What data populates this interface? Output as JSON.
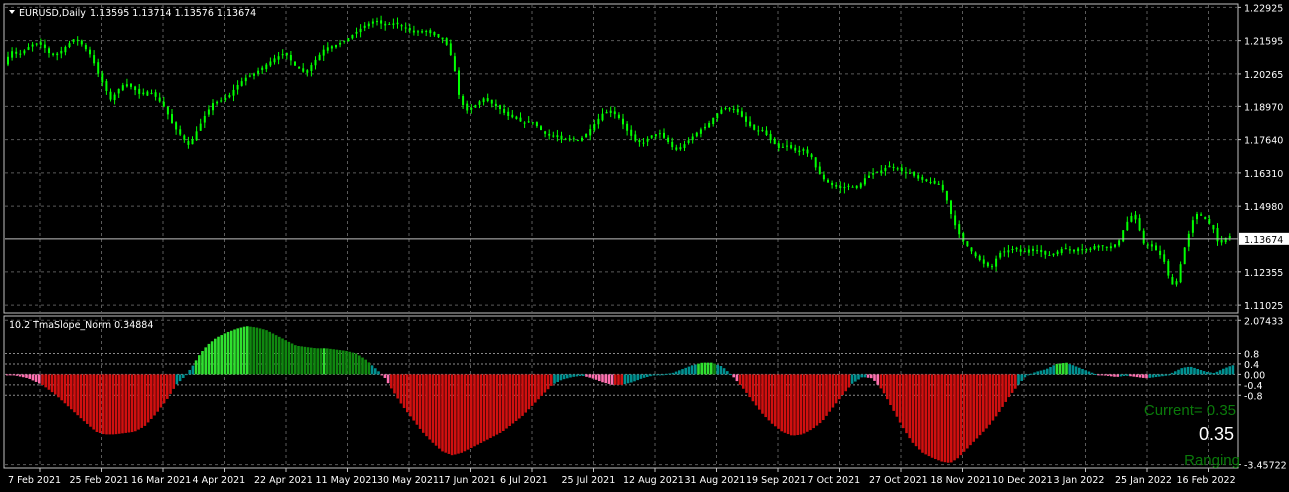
{
  "main_panel": {
    "title": "EURUSD,Daily",
    "ohlc": "1.13595 1.13714 1.13576 1.13674",
    "last_price": "1.13674",
    "price_ticks": [
      "1.22925",
      "1.21595",
      "1.20265",
      "1.18970",
      "1.17640",
      "1.16310",
      "1.14980",
      "1.13674",
      "1.12355",
      "1.11025"
    ]
  },
  "indicator_panel": {
    "title": "10.2 TmaSlope_Norm 0.34884",
    "value_ticks": [
      "2.07433",
      "0.8",
      "0.4",
      "0.00",
      "-0.4",
      "-0.8",
      "-3.45722"
    ],
    "info_current": "Current= 0.35",
    "info_value": "0.35",
    "info_state": "Ranging"
  },
  "time_axis": {
    "labels": [
      "7 Feb 2021",
      "25 Feb 2021",
      "16 Mar 2021",
      "4 Apr 2021",
      "22 Apr 2021",
      "11 May 2021",
      "30 May 2021",
      "17 Jun 2021",
      "6 Jul 2021",
      "25 Jul 2021",
      "12 Aug 2021",
      "31 Aug 2021",
      "19 Sep 2021",
      "7 Oct 2021",
      "27 Oct 2021",
      "18 Nov 2021",
      "10 Dec 2021",
      "3 Jan 2022",
      "25 Jan 2022",
      "16 Feb 2022"
    ]
  },
  "colors": {
    "background": "#000000",
    "grid": "#5a5a5a",
    "candle": "#00ff00",
    "bid_line": "#c0c0c0",
    "hist_red": "#d01010",
    "hist_pink": "#ff70b0",
    "hist_teal": "#009090",
    "hist_lime": "#30e030",
    "hist_green": "#108810"
  },
  "chart_data": [
    {
      "type": "candlestick",
      "title": "EURUSD,Daily",
      "ylim": [
        1.11025,
        1.22925
      ],
      "grid": true,
      "price_path": [
        [
          0,
          1.207
        ],
        [
          6,
          1.212
        ],
        [
          14,
          1.21
        ],
        [
          22,
          1.213
        ],
        [
          30,
          1.215
        ],
        [
          38,
          1.214
        ],
        [
          46,
          1.21
        ],
        [
          54,
          1.211
        ],
        [
          62,
          1.214
        ],
        [
          70,
          1.217
        ],
        [
          78,
          1.214
        ],
        [
          86,
          1.21
        ],
        [
          94,
          1.202
        ],
        [
          100,
          1.197
        ],
        [
          106,
          1.192
        ],
        [
          112,
          1.196
        ],
        [
          120,
          1.199
        ],
        [
          128,
          1.197
        ],
        [
          136,
          1.194
        ],
        [
          144,
          1.196
        ],
        [
          152,
          1.193
        ],
        [
          160,
          1.189
        ],
        [
          168,
          1.182
        ],
        [
          176,
          1.178
        ],
        [
          184,
          1.174
        ],
        [
          192,
          1.18
        ],
        [
          200,
          1.186
        ],
        [
          208,
          1.191
        ],
        [
          216,
          1.192
        ],
        [
          224,
          1.194
        ],
        [
          232,
          1.198
        ],
        [
          240,
          1.201
        ],
        [
          250,
          1.203
        ],
        [
          260,
          1.206
        ],
        [
          270,
          1.209
        ],
        [
          280,
          1.211
        ],
        [
          290,
          1.206
        ],
        [
          300,
          1.203
        ],
        [
          310,
          1.208
        ],
        [
          320,
          1.213
        ],
        [
          330,
          1.214
        ],
        [
          340,
          1.216
        ],
        [
          350,
          1.219
        ],
        [
          360,
          1.222
        ],
        [
          370,
          1.224
        ],
        [
          380,
          1.222
        ],
        [
          390,
          1.223
        ],
        [
          400,
          1.221
        ],
        [
          410,
          1.219
        ],
        [
          420,
          1.22
        ],
        [
          430,
          1.218
        ],
        [
          440,
          1.216
        ],
        [
          448,
          1.208
        ],
        [
          455,
          1.192
        ],
        [
          462,
          1.188
        ],
        [
          470,
          1.19
        ],
        [
          478,
          1.193
        ],
        [
          486,
          1.191
        ],
        [
          494,
          1.189
        ],
        [
          502,
          1.186
        ],
        [
          510,
          1.185
        ],
        [
          518,
          1.183
        ],
        [
          526,
          1.184
        ],
        [
          534,
          1.181
        ],
        [
          542,
          1.178
        ],
        [
          550,
          1.178
        ],
        [
          558,
          1.176
        ],
        [
          566,
          1.177
        ],
        [
          574,
          1.176
        ],
        [
          582,
          1.179
        ],
        [
          590,
          1.183
        ],
        [
          598,
          1.187
        ],
        [
          606,
          1.188
        ],
        [
          614,
          1.185
        ],
        [
          622,
          1.18
        ],
        [
          630,
          1.176
        ],
        [
          638,
          1.175
        ],
        [
          646,
          1.178
        ],
        [
          654,
          1.179
        ],
        [
          662,
          1.176
        ],
        [
          670,
          1.172
        ],
        [
          678,
          1.174
        ],
        [
          686,
          1.177
        ],
        [
          694,
          1.18
        ],
        [
          702,
          1.182
        ],
        [
          710,
          1.186
        ],
        [
          718,
          1.189
        ],
        [
          726,
          1.189
        ],
        [
          734,
          1.187
        ],
        [
          742,
          1.183
        ],
        [
          750,
          1.18
        ],
        [
          758,
          1.18
        ],
        [
          766,
          1.176
        ],
        [
          774,
          1.173
        ],
        [
          782,
          1.174
        ],
        [
          790,
          1.172
        ],
        [
          798,
          1.172
        ],
        [
          806,
          1.17
        ],
        [
          812,
          1.164
        ],
        [
          820,
          1.16
        ],
        [
          828,
          1.158
        ],
        [
          836,
          1.157
        ],
        [
          844,
          1.158
        ],
        [
          852,
          1.157
        ],
        [
          860,
          1.161
        ],
        [
          868,
          1.163
        ],
        [
          876,
          1.164
        ],
        [
          884,
          1.166
        ],
        [
          892,
          1.165
        ],
        [
          900,
          1.163
        ],
        [
          906,
          1.163
        ],
        [
          912,
          1.161
        ],
        [
          920,
          1.16
        ],
        [
          928,
          1.159
        ],
        [
          936,
          1.158
        ],
        [
          942,
          1.152
        ],
        [
          948,
          1.144
        ],
        [
          956,
          1.137
        ],
        [
          962,
          1.134
        ],
        [
          970,
          1.13
        ],
        [
          978,
          1.127
        ],
        [
          986,
          1.125
        ],
        [
          994,
          1.131
        ],
        [
          1002,
          1.132
        ],
        [
          1010,
          1.133
        ],
        [
          1018,
          1.131
        ],
        [
          1026,
          1.133
        ],
        [
          1034,
          1.132
        ],
        [
          1042,
          1.13
        ],
        [
          1050,
          1.131
        ],
        [
          1058,
          1.133
        ],
        [
          1066,
          1.132
        ],
        [
          1074,
          1.133
        ],
        [
          1082,
          1.132
        ],
        [
          1090,
          1.134
        ],
        [
          1098,
          1.134
        ],
        [
          1106,
          1.133
        ],
        [
          1114,
          1.136
        ],
        [
          1120,
          1.142
        ],
        [
          1126,
          1.146
        ],
        [
          1132,
          1.144
        ],
        [
          1138,
          1.135
        ],
        [
          1146,
          1.134
        ],
        [
          1154,
          1.131
        ],
        [
          1160,
          1.127
        ],
        [
          1166,
          1.118
        ],
        [
          1172,
          1.12
        ],
        [
          1178,
          1.131
        ],
        [
          1184,
          1.139
        ],
        [
          1190,
          1.147
        ],
        [
          1196,
          1.146
        ],
        [
          1202,
          1.144
        ],
        [
          1208,
          1.141
        ],
        [
          1214,
          1.134
        ],
        [
          1220,
          1.137
        ],
        [
          1226,
          1.138
        ],
        [
          1232,
          1.137
        ]
      ],
      "last_price": 1.13674
    },
    {
      "type": "bar",
      "title": "10.2 TmaSlope_Norm 0.34884",
      "ylim": [
        -3.45722,
        2.07433
      ],
      "levels": [
        0.8,
        0.4,
        0,
        -0.4,
        -0.8
      ],
      "grid": true,
      "slope_path": [
        [
          0,
          0.0
        ],
        [
          10,
          -0.05
        ],
        [
          22,
          -0.15
        ],
        [
          36,
          -0.4
        ],
        [
          50,
          -0.8
        ],
        [
          64,
          -1.3
        ],
        [
          78,
          -1.8
        ],
        [
          90,
          -2.2
        ],
        [
          98,
          -2.3
        ],
        [
          108,
          -2.3
        ],
        [
          118,
          -2.25
        ],
        [
          128,
          -2.2
        ],
        [
          138,
          -2.0
        ],
        [
          150,
          -1.5
        ],
        [
          160,
          -1.0
        ],
        [
          170,
          -0.4
        ],
        [
          178,
          -0.1
        ],
        [
          186,
          0.3
        ],
        [
          194,
          0.8
        ],
        [
          202,
          1.15
        ],
        [
          210,
          1.4
        ],
        [
          220,
          1.6
        ],
        [
          230,
          1.75
        ],
        [
          240,
          1.85
        ],
        [
          250,
          1.8
        ],
        [
          260,
          1.7
        ],
        [
          270,
          1.5
        ],
        [
          280,
          1.3
        ],
        [
          290,
          1.1
        ],
        [
          300,
          1.05
        ],
        [
          310,
          1.0
        ],
        [
          320,
          1.0
        ],
        [
          330,
          0.95
        ],
        [
          340,
          0.9
        ],
        [
          350,
          0.8
        ],
        [
          360,
          0.55
        ],
        [
          370,
          0.2
        ],
        [
          378,
          -0.1
        ],
        [
          386,
          -0.6
        ],
        [
          396,
          -1.2
        ],
        [
          406,
          -1.7
        ],
        [
          416,
          -2.2
        ],
        [
          426,
          -2.6
        ],
        [
          436,
          -2.95
        ],
        [
          446,
          -3.1
        ],
        [
          456,
          -3.0
        ],
        [
          466,
          -2.8
        ],
        [
          476,
          -2.6
        ],
        [
          486,
          -2.4
        ],
        [
          496,
          -2.2
        ],
        [
          506,
          -1.9
        ],
        [
          516,
          -1.6
        ],
        [
          526,
          -1.2
        ],
        [
          536,
          -0.8
        ],
        [
          546,
          -0.4
        ],
        [
          556,
          -0.2
        ],
        [
          566,
          -0.1
        ],
        [
          576,
          -0.05
        ],
        [
          586,
          -0.15
        ],
        [
          596,
          -0.3
        ],
        [
          606,
          -0.4
        ],
        [
          616,
          -0.4
        ],
        [
          626,
          -0.3
        ],
        [
          636,
          -0.15
        ],
        [
          646,
          -0.05
        ],
        [
          656,
          0.0
        ],
        [
          666,
          0.05
        ],
        [
          676,
          0.2
        ],
        [
          686,
          0.35
        ],
        [
          696,
          0.45
        ],
        [
          706,
          0.45
        ],
        [
          716,
          0.3
        ],
        [
          726,
          -0.05
        ],
        [
          736,
          -0.5
        ],
        [
          746,
          -1.0
        ],
        [
          756,
          -1.5
        ],
        [
          766,
          -1.9
        ],
        [
          776,
          -2.2
        ],
        [
          786,
          -2.35
        ],
        [
          796,
          -2.3
        ],
        [
          806,
          -2.1
        ],
        [
          816,
          -1.8
        ],
        [
          826,
          -1.3
        ],
        [
          836,
          -0.8
        ],
        [
          846,
          -0.35
        ],
        [
          856,
          -0.1
        ],
        [
          866,
          -0.15
        ],
        [
          876,
          -0.6
        ],
        [
          886,
          -1.3
        ],
        [
          896,
          -2.0
        ],
        [
          906,
          -2.6
        ],
        [
          916,
          -3.0
        ],
        [
          926,
          -3.2
        ],
        [
          936,
          -3.35
        ],
        [
          944,
          -3.4
        ],
        [
          952,
          -3.2
        ],
        [
          962,
          -2.8
        ],
        [
          972,
          -2.4
        ],
        [
          982,
          -2.0
        ],
        [
          992,
          -1.5
        ],
        [
          1002,
          -0.9
        ],
        [
          1012,
          -0.4
        ],
        [
          1020,
          -0.05
        ],
        [
          1030,
          0.1
        ],
        [
          1040,
          0.2
        ],
        [
          1050,
          0.4
        ],
        [
          1060,
          0.45
        ],
        [
          1070,
          0.3
        ],
        [
          1080,
          0.15
        ],
        [
          1090,
          0.0
        ],
        [
          1100,
          -0.05
        ],
        [
          1110,
          -0.1
        ],
        [
          1120,
          -0.05
        ],
        [
          1130,
          -0.1
        ],
        [
          1140,
          -0.15
        ],
        [
          1150,
          -0.1
        ],
        [
          1160,
          -0.05
        ],
        [
          1168,
          0.1
        ],
        [
          1176,
          0.25
        ],
        [
          1184,
          0.3
        ],
        [
          1192,
          0.2
        ],
        [
          1200,
          0.1
        ],
        [
          1208,
          0.05
        ],
        [
          1216,
          0.2
        ],
        [
          1226,
          0.35
        ],
        [
          1232,
          0.35
        ]
      ]
    }
  ]
}
